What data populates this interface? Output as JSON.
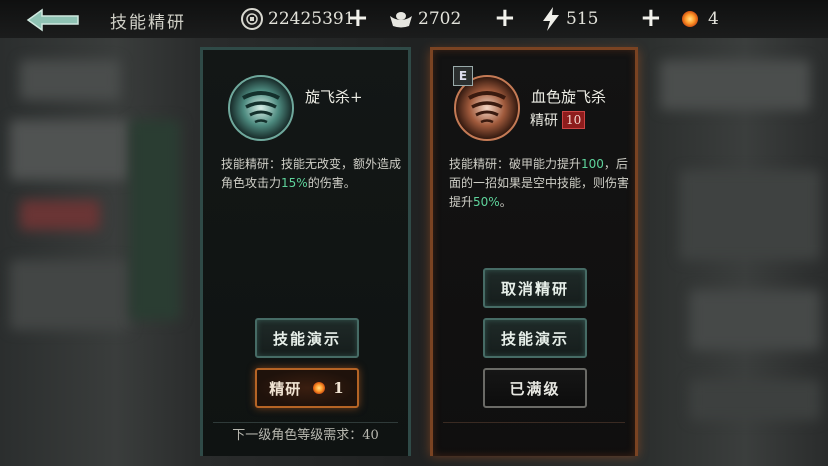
{
  "header": {
    "title": "技能精研",
    "resources": [
      {
        "name": "coin",
        "icon": "coin-icon",
        "value": "22425391"
      },
      {
        "name": "silver",
        "icon": "ingot-icon",
        "value": "2702"
      },
      {
        "name": "energy",
        "icon": "lightning-icon",
        "value": "515"
      },
      {
        "name": "ember",
        "icon": "ember-icon",
        "value": "4"
      }
    ],
    "plus_label": "+"
  },
  "left_card": {
    "skill_name": "旋飞杀+",
    "description_prefix": "技能精研：技能无改变，额外造成角色攻击力",
    "description_highlight": "15%",
    "description_suffix": "的伤害。",
    "demo_button": "技能演示",
    "refine_button": "精研",
    "refine_cost": "1",
    "requirement": "下一级角色等级需求：40"
  },
  "right_card": {
    "badge": "E",
    "skill_name": "血色旋飞杀",
    "refine_label": "精研",
    "refine_level": "10",
    "desc_part1": "技能精研：破甲能力提升",
    "desc_hl1": "100",
    "desc_part2": "，后面的一招如果是空中技能，则伤害提升",
    "desc_hl2": "50%",
    "desc_part3": "。",
    "cancel_button": "取消精研",
    "demo_button": "技能演示",
    "maxed_button": "已满级"
  },
  "colors": {
    "highlight_green": "#5ed39b",
    "left_frame": "#2f4a47",
    "right_frame": "#7a4322",
    "level_badge": "#8e1c1c"
  }
}
